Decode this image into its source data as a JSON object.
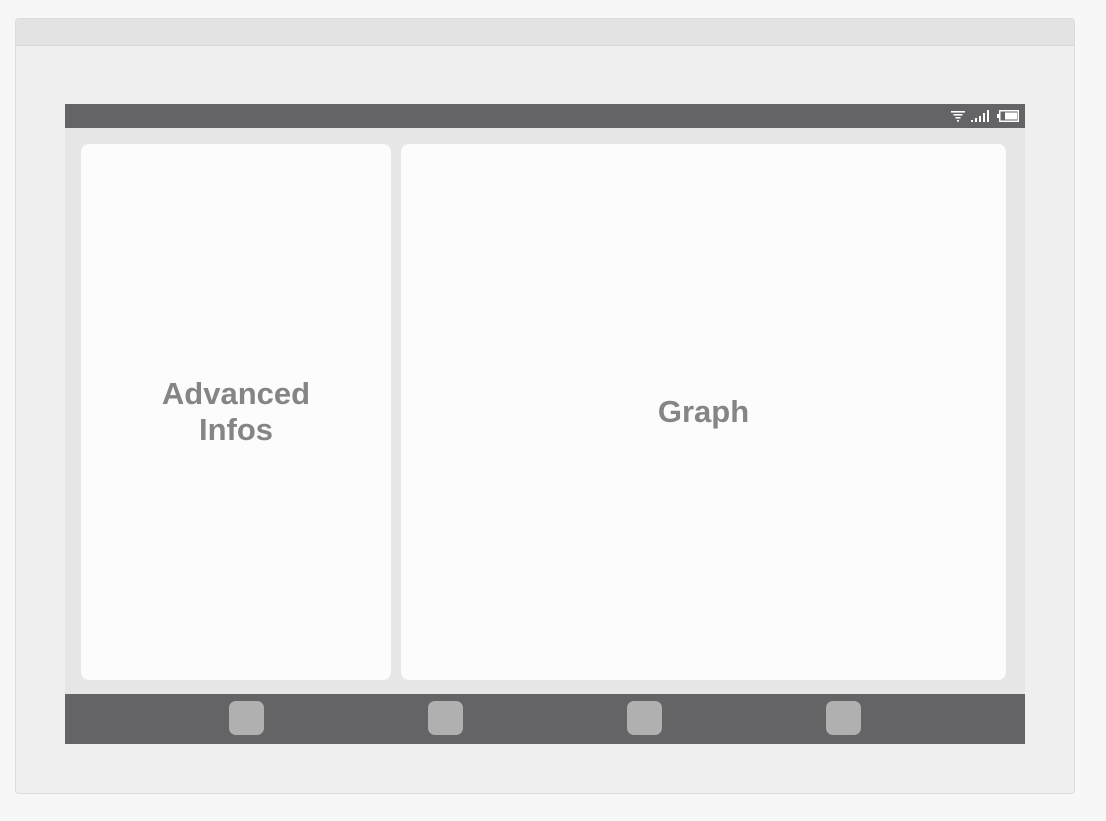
{
  "status_bar": {
    "icons": [
      "wifi-icon",
      "signal-icon",
      "battery-icon"
    ]
  },
  "panels": {
    "left": {
      "label": "Advanced Infos"
    },
    "right": {
      "label": "Graph"
    }
  },
  "nav_bar": {
    "buttons": [
      "nav-button-1",
      "nav-button-2",
      "nav-button-3",
      "nav-button-4"
    ]
  },
  "colors": {
    "page_background": "#f7f7f7",
    "frame_background": "#efefef",
    "device_background": "#e6e6e6",
    "bar_color": "#646466",
    "panel_color": "#fcfcfc",
    "panel_text": "#858585",
    "nav_button": "#b0b0b0"
  }
}
